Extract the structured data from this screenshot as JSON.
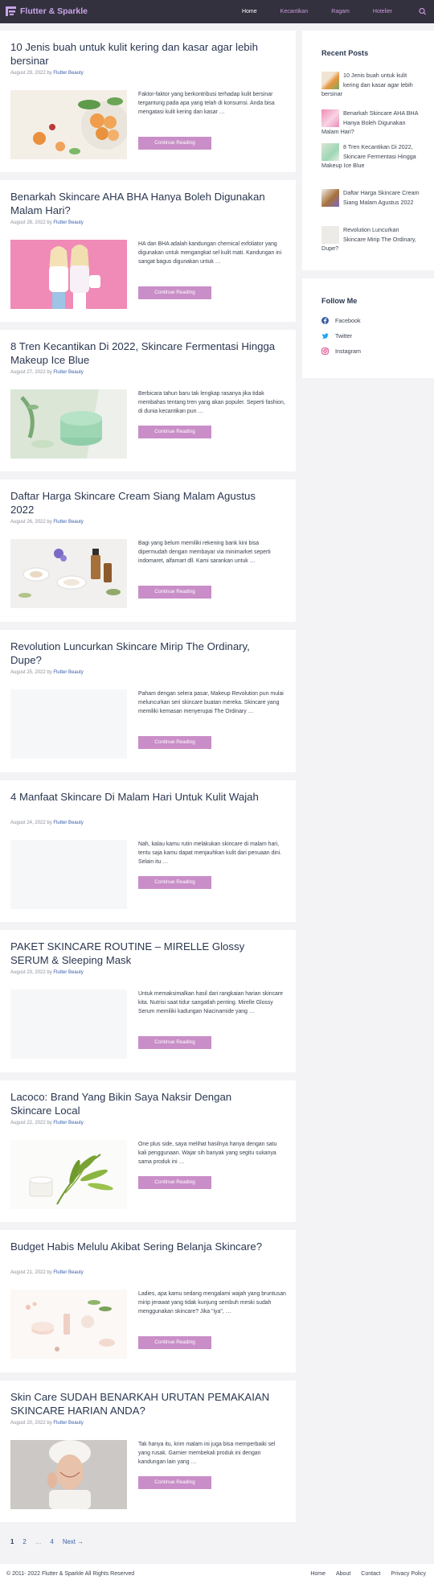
{
  "header": {
    "site_title": "Flutter & Sparkle",
    "nav": [
      {
        "label": "Home",
        "active": true
      },
      {
        "label": "Kecantikan",
        "active": false
      },
      {
        "label": "Ragam",
        "active": false
      },
      {
        "label": "Hotelier",
        "active": false
      }
    ],
    "search_icon": "search-icon"
  },
  "colors": {
    "header_bg": "#34313f",
    "accent": "#c98ec8",
    "title": "#2a3750",
    "link": "#3a5ea8",
    "background": "#f3f3f5"
  },
  "posts": [
    {
      "title": "10 Jenis buah untuk kulit kering dan kasar agar lebih bersinar",
      "date": "August 29, 2022",
      "by": "by",
      "author": "Flutter Beauty",
      "excerpt": "Faktor-faktor yang berkontribusi terhadap kulit bersinar tergantung pada apa yang telah di konsumsi. Anda bisa mengatasi kulit kering dan kasar …",
      "button": "Continue Reading"
    },
    {
      "title": "Benarkah Skincare AHA BHA Hanya Boleh Digunakan Malam Hari?",
      "date": "August 28, 2022",
      "by": "by",
      "author": "Flutter Beauty",
      "excerpt": "HA dan BHA adalah kandungan chemical exfoliator yang digunakan untuk mengangkat sel kulit mati. Kandungan ini sangat bagus digunakan untuk …",
      "button": "Continue Reading"
    },
    {
      "title": "8 Tren Kecantikan Di 2022, Skincare Fermentasi Hingga Makeup Ice Blue",
      "date": "August 27, 2022",
      "by": "by",
      "author": "Flutter Beauty",
      "excerpt": "Berbicara tahun baru tak lengkap rasanya jika tidak membahas tentang tren yang akan populer. Seperti fashion, di dunia kecantikan pun …",
      "button": "Continue Reading"
    },
    {
      "title": "Daftar Harga Skincare Cream Siang Malam Agustus 2022",
      "date": "August 26, 2022",
      "by": "by",
      "author": "Flutter Beauty",
      "excerpt": "Bagi yang belum memiliki rekening bank kini bisa dipermudah dengan membayar via minimarket seperti indomaret, alfamart dll. Kami sarankan untuk …",
      "button": "Continue Reading"
    },
    {
      "title": "Revolution Luncurkan Skincare Mirip The Ordinary, Dupe?",
      "date": "August 25, 2022",
      "by": "by",
      "author": "Flutter Beauty",
      "excerpt": "Paham dengan selera pasar, Makeup Revolution pun mulai meluncurkan seri skincare buatan mereka. Skincare yang memiliki kemasan menyerupai The Ordinary …",
      "button": "Continue Reading"
    },
    {
      "title": "4 Manfaat Skincare Di Malam Hari Untuk Kulit Wajah",
      "date": "August 24, 2022",
      "by": "by",
      "author": "Flutter Beauty",
      "excerpt": "Nah, kalau kamu rutin melakukan skincare di malam hari, tentu saja kamu dapat menjauhkan kulit dari penuaan dini. Selain itu …",
      "button": "Continue Reading"
    },
    {
      "title": "PAKET SKINCARE ROUTINE – MIRELLE Glossy SERUM & Sleeping Mask",
      "date": "August 23, 2022",
      "by": "by",
      "author": "Flutter Beauty",
      "excerpt": "Untuk memaksimalkan hasil dari rangkaian harian skincare kita. Nutrisi saat tidur sangatlah penting. Mirelle Glossy Serum memiliki kadungan Niacinamide yang …",
      "button": "Continue Reading"
    },
    {
      "title": "Lacoco: Brand Yang Bikin Saya Naksir Dengan Skincare Local",
      "date": "August 22, 2022",
      "by": "by",
      "author": "Flutter Beauty",
      "excerpt": "One plus side, saya melihat hasilnya hanya dengan satu kali penggunaan. Wajar sih banyak yang segitu sukanya sama produk ini …",
      "button": "Continue Reading"
    },
    {
      "title": "Budget Habis Melulu Akibat Sering Belanja Skincare?",
      "date": "August 21, 2022",
      "by": "by",
      "author": "Flutter Beauty",
      "excerpt": "Ladies, apa kamu sedang mengalami wajah yang bruntusan mirip jerawat yang tidak kunjung sembuh meski sudah menggunakan skincare? Jika \"iya\", …",
      "button": "Continue Reading"
    },
    {
      "title": "Skin Care SUDAH BENARKAH URUTAN PEMAKAIAN SKINCARE HARIAN ANDA?",
      "date": "August 20, 2022",
      "by": "by",
      "author": "Flutter Beauty",
      "excerpt": "Tak hanya itu, krim malam ini juga bisa memperbaiki sel yang rusak. Garnier membekali produk ini dengan kandungan lain yang …",
      "button": "Continue Reading"
    }
  ],
  "sidebar": {
    "recent_title": "Recent Posts",
    "recent": [
      "10 Jenis buah untuk kulit kering dan kasar agar lebih bersinar",
      "Benarkah Skincare AHA BHA Hanya Boleh Digunakan Malam Hari?",
      "8 Tren Kecantikan Di 2022, Skincare Fermentasi Hingga Makeup Ice Blue",
      "Daftar Harga Skincare Cream Siang Malam Agustus 2022",
      "Revolution Luncurkan Skincare Mirip The Ordinary, Dupe?"
    ],
    "follow_title": "Follow Me",
    "follow": [
      {
        "label": "Facebook",
        "icon": "facebook-icon"
      },
      {
        "label": "Twitter",
        "icon": "twitter-icon"
      },
      {
        "label": "Instagram",
        "icon": "instagram-icon"
      }
    ]
  },
  "pagination": {
    "current": "1",
    "page2": "2",
    "dots": "…",
    "last": "4",
    "next": "Next →"
  },
  "footer": {
    "copyright": "© 2011- 2022 Flutter & Sparkle All Rights Reserved",
    "links": [
      "Home",
      "About",
      "Contact",
      "Privacy Policy"
    ]
  }
}
